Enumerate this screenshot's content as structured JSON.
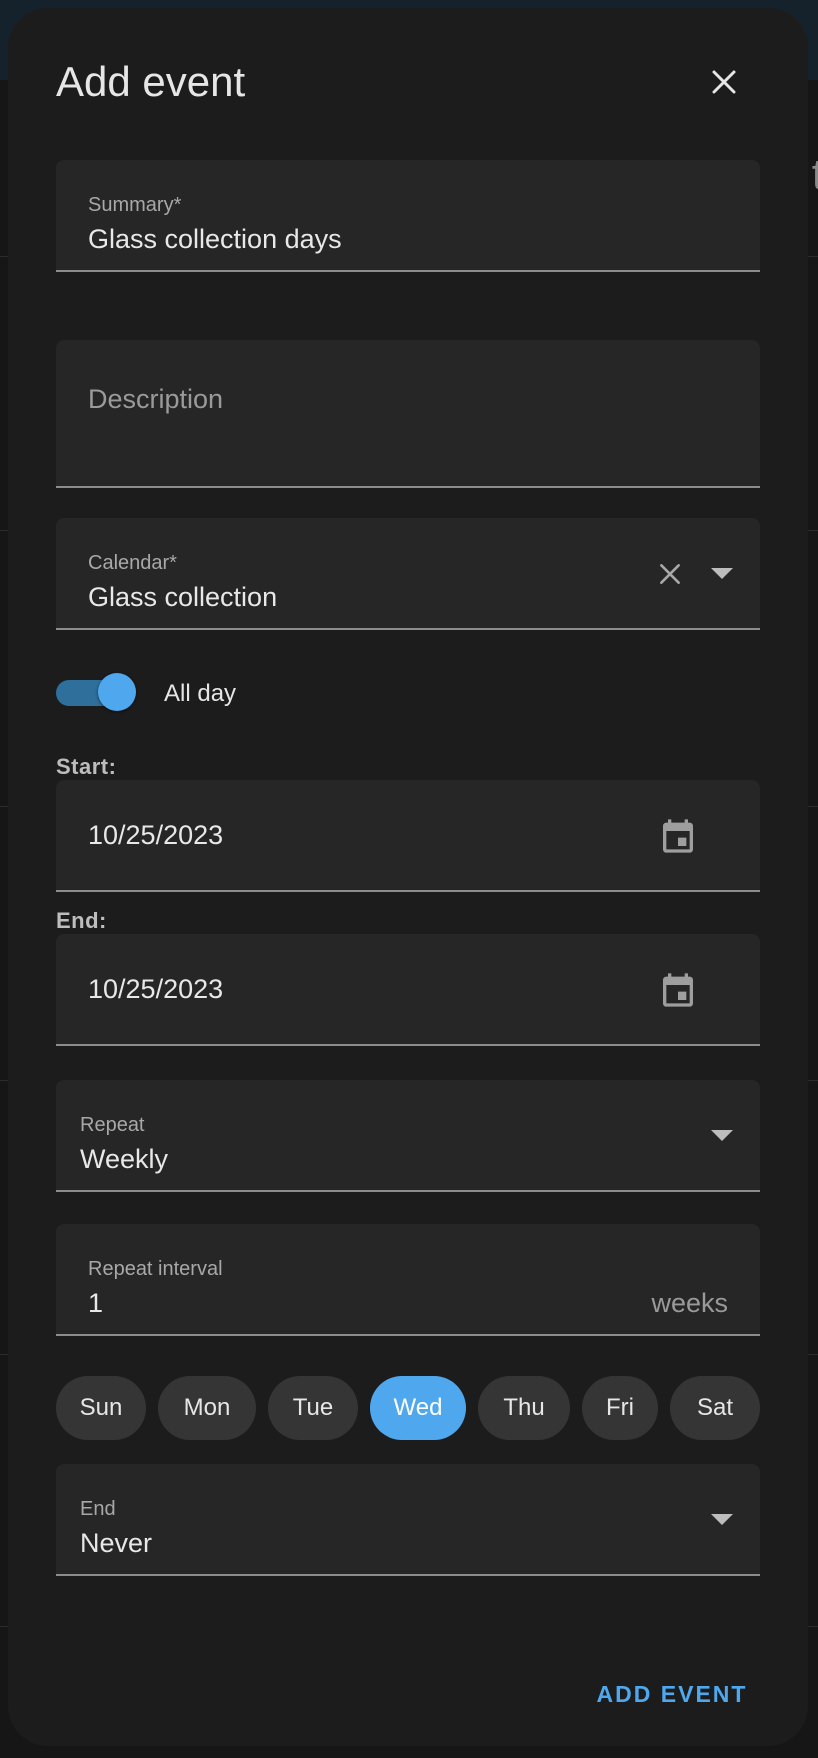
{
  "background": {
    "partial_text": "t"
  },
  "dialog": {
    "title": "Add event",
    "close_icon": "close-icon"
  },
  "summary": {
    "label": "Summary*",
    "value": "Glass collection days"
  },
  "description": {
    "placeholder": "Description",
    "value": ""
  },
  "calendar": {
    "label": "Calendar*",
    "value": "Glass collection",
    "clear_icon": "close-icon",
    "dropdown_icon": "caret-down-icon"
  },
  "all_day": {
    "label": "All day",
    "checked": true
  },
  "start": {
    "label": "Start:",
    "date": "10/25/2023",
    "icon": "calendar-icon"
  },
  "end_date": {
    "label": "End:",
    "date": "10/25/2023",
    "icon": "calendar-icon"
  },
  "repeat": {
    "label": "Repeat",
    "value": "Weekly",
    "dropdown_icon": "caret-down-icon"
  },
  "repeat_interval": {
    "label": "Repeat interval",
    "value": "1",
    "suffix": "weeks"
  },
  "weekdays": [
    {
      "label": "Sun",
      "selected": false
    },
    {
      "label": "Mon",
      "selected": false
    },
    {
      "label": "Tue",
      "selected": false
    },
    {
      "label": "Wed",
      "selected": true
    },
    {
      "label": "Thu",
      "selected": false
    },
    {
      "label": "Fri",
      "selected": false
    },
    {
      "label": "Sat",
      "selected": false
    }
  ],
  "ends": {
    "label": "End",
    "value": "Never",
    "dropdown_icon": "caret-down-icon"
  },
  "actions": {
    "add_label": "ADD EVENT"
  },
  "colors": {
    "accent": "#4fa8ee",
    "dialog_bg": "#1c1c1c",
    "field_bg": "#262626"
  }
}
